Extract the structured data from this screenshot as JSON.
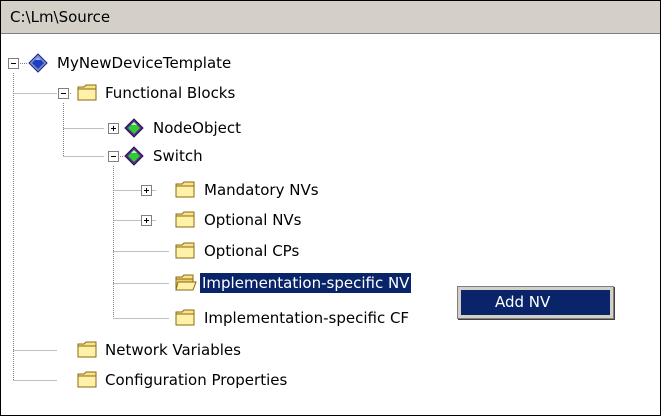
{
  "header": {
    "path": "C:\\Lm\\Source"
  },
  "tree": {
    "items": [
      {
        "label": "MyNewDeviceTemplate",
        "icon": "device-diamond-blue-icon",
        "expander": "minus"
      },
      {
        "label": "Functional Blocks",
        "icon": "folder-icon",
        "expander": "minus"
      },
      {
        "label": "NodeObject",
        "icon": "functional-block-diamond-green-icon",
        "expander": "plus"
      },
      {
        "label": "Switch",
        "icon": "functional-block-diamond-green-icon",
        "expander": "minus"
      },
      {
        "label": "Mandatory NVs",
        "icon": "folder-icon",
        "expander": "plus"
      },
      {
        "label": "Optional NVs",
        "icon": "folder-icon",
        "expander": "plus"
      },
      {
        "label": "Optional CPs",
        "icon": "folder-icon",
        "expander": "none"
      },
      {
        "label": "Implementation-specific NV",
        "icon": "folder-open-icon",
        "expander": "none",
        "selected": true
      },
      {
        "label": "Implementation-specific CF",
        "icon": "folder-icon",
        "expander": "none"
      },
      {
        "label": "Network Variables",
        "icon": "folder-icon",
        "expander": "none"
      },
      {
        "label": "Configuration Properties",
        "icon": "folder-icon",
        "expander": "none"
      }
    ]
  },
  "context_menu": {
    "items": [
      {
        "label": "Add NV",
        "highlighted": true
      }
    ]
  },
  "colors": {
    "selection": "#0a246a",
    "header_bg": "#d4d0c8",
    "folder_fill": "#f8e28a",
    "diamond_blue": "#1f3fbf",
    "diamond_green": "#2dcc32"
  }
}
